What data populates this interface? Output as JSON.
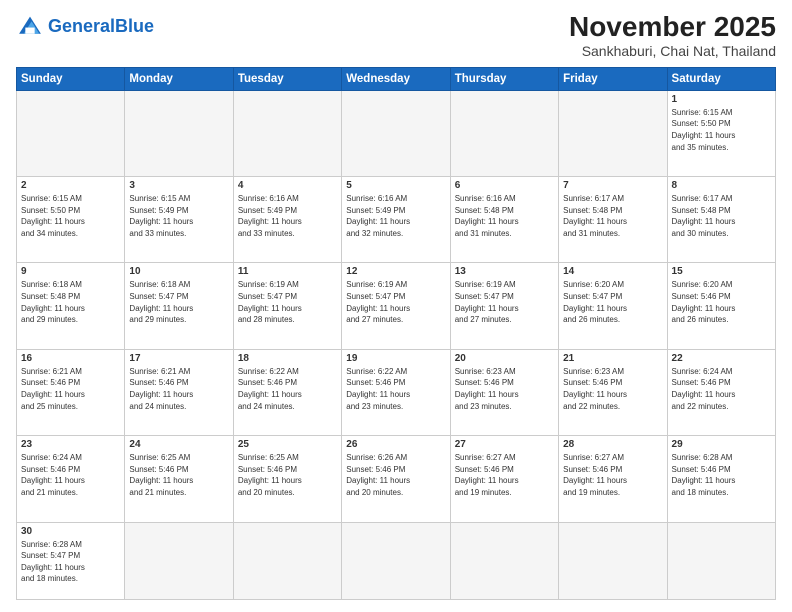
{
  "header": {
    "logo_general": "General",
    "logo_blue": "Blue",
    "month_title": "November 2025",
    "location": "Sankhaburi, Chai Nat, Thailand"
  },
  "days_of_week": [
    "Sunday",
    "Monday",
    "Tuesday",
    "Wednesday",
    "Thursday",
    "Friday",
    "Saturday"
  ],
  "weeks": [
    [
      {
        "day": "",
        "info": ""
      },
      {
        "day": "",
        "info": ""
      },
      {
        "day": "",
        "info": ""
      },
      {
        "day": "",
        "info": ""
      },
      {
        "day": "",
        "info": ""
      },
      {
        "day": "",
        "info": ""
      },
      {
        "day": "1",
        "info": "Sunrise: 6:15 AM\nSunset: 5:50 PM\nDaylight: 11 hours\nand 35 minutes."
      }
    ],
    [
      {
        "day": "2",
        "info": "Sunrise: 6:15 AM\nSunset: 5:50 PM\nDaylight: 11 hours\nand 34 minutes."
      },
      {
        "day": "3",
        "info": "Sunrise: 6:15 AM\nSunset: 5:49 PM\nDaylight: 11 hours\nand 33 minutes."
      },
      {
        "day": "4",
        "info": "Sunrise: 6:16 AM\nSunset: 5:49 PM\nDaylight: 11 hours\nand 33 minutes."
      },
      {
        "day": "5",
        "info": "Sunrise: 6:16 AM\nSunset: 5:49 PM\nDaylight: 11 hours\nand 32 minutes."
      },
      {
        "day": "6",
        "info": "Sunrise: 6:16 AM\nSunset: 5:48 PM\nDaylight: 11 hours\nand 31 minutes."
      },
      {
        "day": "7",
        "info": "Sunrise: 6:17 AM\nSunset: 5:48 PM\nDaylight: 11 hours\nand 31 minutes."
      },
      {
        "day": "8",
        "info": "Sunrise: 6:17 AM\nSunset: 5:48 PM\nDaylight: 11 hours\nand 30 minutes."
      }
    ],
    [
      {
        "day": "9",
        "info": "Sunrise: 6:18 AM\nSunset: 5:48 PM\nDaylight: 11 hours\nand 29 minutes."
      },
      {
        "day": "10",
        "info": "Sunrise: 6:18 AM\nSunset: 5:47 PM\nDaylight: 11 hours\nand 29 minutes."
      },
      {
        "day": "11",
        "info": "Sunrise: 6:19 AM\nSunset: 5:47 PM\nDaylight: 11 hours\nand 28 minutes."
      },
      {
        "day": "12",
        "info": "Sunrise: 6:19 AM\nSunset: 5:47 PM\nDaylight: 11 hours\nand 27 minutes."
      },
      {
        "day": "13",
        "info": "Sunrise: 6:19 AM\nSunset: 5:47 PM\nDaylight: 11 hours\nand 27 minutes."
      },
      {
        "day": "14",
        "info": "Sunrise: 6:20 AM\nSunset: 5:47 PM\nDaylight: 11 hours\nand 26 minutes."
      },
      {
        "day": "15",
        "info": "Sunrise: 6:20 AM\nSunset: 5:46 PM\nDaylight: 11 hours\nand 26 minutes."
      }
    ],
    [
      {
        "day": "16",
        "info": "Sunrise: 6:21 AM\nSunset: 5:46 PM\nDaylight: 11 hours\nand 25 minutes."
      },
      {
        "day": "17",
        "info": "Sunrise: 6:21 AM\nSunset: 5:46 PM\nDaylight: 11 hours\nand 24 minutes."
      },
      {
        "day": "18",
        "info": "Sunrise: 6:22 AM\nSunset: 5:46 PM\nDaylight: 11 hours\nand 24 minutes."
      },
      {
        "day": "19",
        "info": "Sunrise: 6:22 AM\nSunset: 5:46 PM\nDaylight: 11 hours\nand 23 minutes."
      },
      {
        "day": "20",
        "info": "Sunrise: 6:23 AM\nSunset: 5:46 PM\nDaylight: 11 hours\nand 23 minutes."
      },
      {
        "day": "21",
        "info": "Sunrise: 6:23 AM\nSunset: 5:46 PM\nDaylight: 11 hours\nand 22 minutes."
      },
      {
        "day": "22",
        "info": "Sunrise: 6:24 AM\nSunset: 5:46 PM\nDaylight: 11 hours\nand 22 minutes."
      }
    ],
    [
      {
        "day": "23",
        "info": "Sunrise: 6:24 AM\nSunset: 5:46 PM\nDaylight: 11 hours\nand 21 minutes."
      },
      {
        "day": "24",
        "info": "Sunrise: 6:25 AM\nSunset: 5:46 PM\nDaylight: 11 hours\nand 21 minutes."
      },
      {
        "day": "25",
        "info": "Sunrise: 6:25 AM\nSunset: 5:46 PM\nDaylight: 11 hours\nand 20 minutes."
      },
      {
        "day": "26",
        "info": "Sunrise: 6:26 AM\nSunset: 5:46 PM\nDaylight: 11 hours\nand 20 minutes."
      },
      {
        "day": "27",
        "info": "Sunrise: 6:27 AM\nSunset: 5:46 PM\nDaylight: 11 hours\nand 19 minutes."
      },
      {
        "day": "28",
        "info": "Sunrise: 6:27 AM\nSunset: 5:46 PM\nDaylight: 11 hours\nand 19 minutes."
      },
      {
        "day": "29",
        "info": "Sunrise: 6:28 AM\nSunset: 5:46 PM\nDaylight: 11 hours\nand 18 minutes."
      }
    ],
    [
      {
        "day": "30",
        "info": "Sunrise: 6:28 AM\nSunset: 5:47 PM\nDaylight: 11 hours\nand 18 minutes."
      },
      {
        "day": "",
        "info": ""
      },
      {
        "day": "",
        "info": ""
      },
      {
        "day": "",
        "info": ""
      },
      {
        "day": "",
        "info": ""
      },
      {
        "day": "",
        "info": ""
      },
      {
        "day": "",
        "info": ""
      }
    ]
  ],
  "colors": {
    "header_bg": "#1a6abf",
    "logo_blue": "#1a6abf"
  }
}
